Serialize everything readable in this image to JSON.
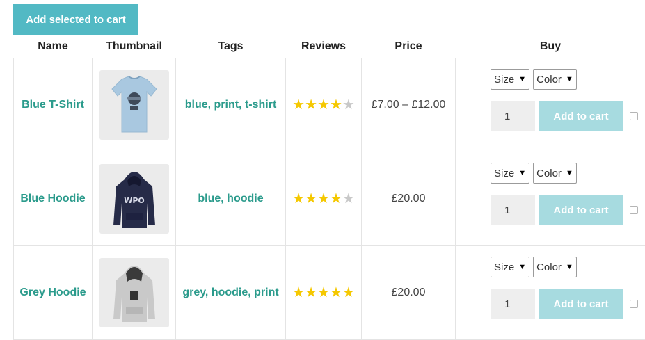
{
  "toolbar": {
    "add_selected_label": "Add selected to cart"
  },
  "table": {
    "headers": {
      "name": "Name",
      "thumbnail": "Thumbnail",
      "tags": "Tags",
      "reviews": "Reviews",
      "price": "Price",
      "buy": "Buy"
    },
    "rows": [
      {
        "name": "Blue T-Shirt",
        "thumbnail_icon": "blue-tshirt-image",
        "tags": [
          "blue",
          "print",
          "t-shirt"
        ],
        "rating": 4,
        "rating_max": 5,
        "price": "£7.00 – £12.00",
        "size_select": "Size",
        "color_select": "Color",
        "quantity": "1",
        "add_to_cart_label": "Add to cart",
        "selected": false
      },
      {
        "name": "Blue Hoodie",
        "thumbnail_icon": "blue-hoodie-image",
        "tags": [
          "blue",
          "hoodie"
        ],
        "rating": 4,
        "rating_max": 5,
        "price": "£20.00",
        "size_select": "Size",
        "color_select": "Color",
        "quantity": "1",
        "add_to_cart_label": "Add to cart",
        "selected": false
      },
      {
        "name": "Grey Hoodie",
        "thumbnail_icon": "grey-hoodie-image",
        "tags": [
          "grey",
          "hoodie",
          "print"
        ],
        "rating": 5,
        "rating_max": 5,
        "price": "£20.00",
        "size_select": "Size",
        "color_select": "Color",
        "quantity": "1",
        "add_to_cart_label": "Add to cart",
        "selected": false
      }
    ]
  },
  "colors": {
    "accent": "#52b9c4",
    "link": "#2b9b8c",
    "star": "#f5c800",
    "star_empty": "#c8c8c8",
    "add_to_cart_disabled": "#a7dbe0"
  }
}
